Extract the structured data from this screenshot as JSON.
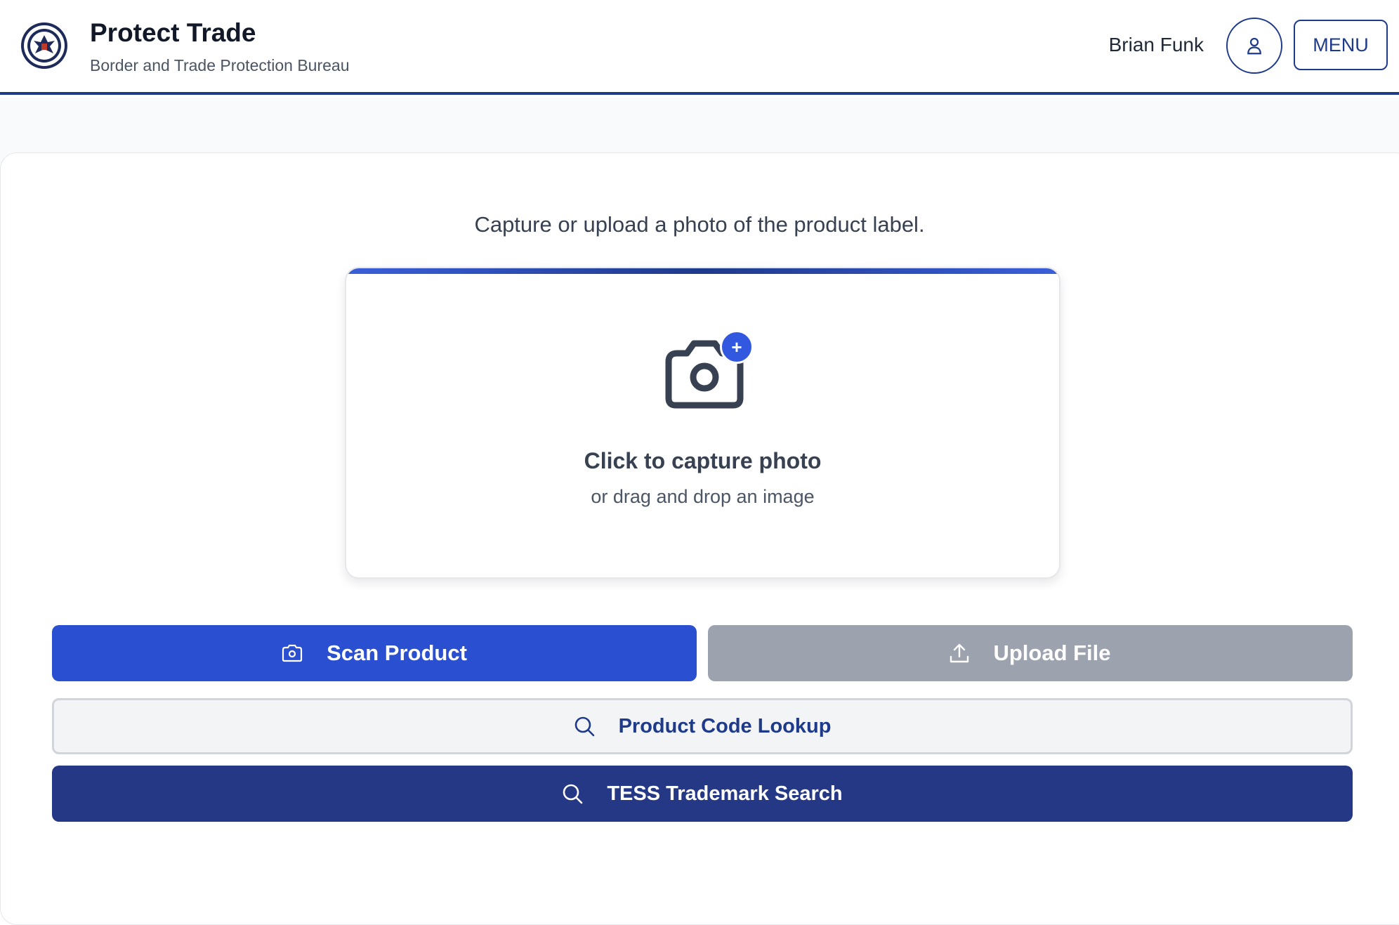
{
  "header": {
    "title": "Protect Trade",
    "subtitle": "Border and Trade Protection Bureau",
    "user_name": "Brian Funk",
    "menu_label": "MENU"
  },
  "main": {
    "instruction": "Capture or upload a photo of the product label.",
    "dropzone": {
      "title": "Click to capture photo",
      "subtitle": "or drag and drop an image",
      "badge": "+"
    },
    "buttons": {
      "scan": "Scan Product",
      "upload": "Upload File",
      "lookup": "Product Code Lookup",
      "tess": "TESS Trademark Search"
    }
  },
  "colors": {
    "primary": "#2b4fd1",
    "navy": "#253886",
    "disabled": "#9ca3af",
    "accent_border": "#1e3a8a"
  },
  "icons": [
    "seal-logo",
    "user-icon",
    "camera-icon",
    "plus-icon",
    "upload-icon",
    "search-icon"
  ]
}
